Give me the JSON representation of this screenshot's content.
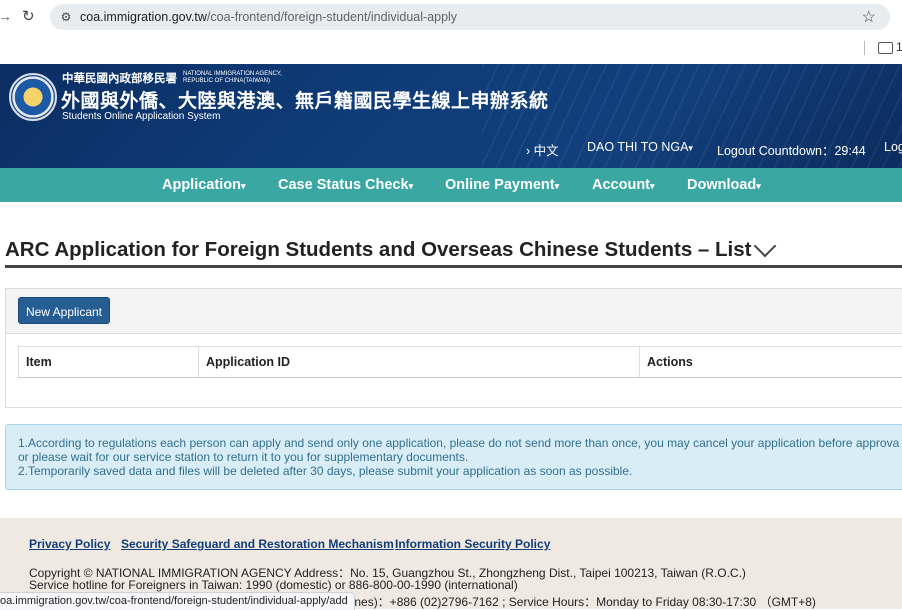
{
  "browser": {
    "url_host": "coa.immigration.gov.tw",
    "url_path": "/coa-frontend/foreign-student/individual-apply",
    "bookmark_label": "1",
    "status_url": "oa.immigration.gov.tw/coa-frontend/foreign-student/individual-apply/add"
  },
  "header": {
    "agency_cn": "中華民國內政部移民署",
    "agency_en": "NATIONAL IMMIGRATION AGENCY, REPUBLIC OF CHINA(TAIWAN)",
    "system_cn": "外國與外僑、大陸與港澳、無戶籍國民學生線上申辦系統",
    "system_en": "Students Online Application System",
    "lang_link": "› 中文",
    "user_name": "DAO THI TO NGA",
    "countdown_label": "Logout Countdown：",
    "countdown_value": "29:44",
    "logout_label": "Log"
  },
  "menu": {
    "items": [
      {
        "label": "Application"
      },
      {
        "label": "Case Status Check"
      },
      {
        "label": "Online Payment"
      },
      {
        "label": "Account"
      },
      {
        "label": "Download"
      }
    ]
  },
  "main": {
    "title": "ARC Application for Foreign Students and Overseas Chinese Students – List",
    "new_button": "New Applicant",
    "columns": [
      "Item",
      "Application ID",
      "Actions"
    ],
    "rows": []
  },
  "notice": {
    "line1": "1.According to regulations each person can apply and send only one application, please do not send more than once, you may cancel your application before approva",
    "line2": "or please wait for our service station to return it to you for supplementary documents.",
    "line3": "2.Temporarily saved data and files will be deleted after 30 days, please submit your application as soon as possible."
  },
  "footer": {
    "links": [
      "Privacy Policy",
      "Security Safeguard and Restoration Mechanism",
      "Information Security Policy"
    ],
    "copyright": "Copyright © NATIONAL IMMIGRATION AGENCY Address：No. 15, Guangzhou St., Zhongzheng Dist., Taipei 100213, Taiwan (R.O.C.)",
    "hotline": "Service hotline for Foreigners in Taiwan: 1990 (domestic) or 886-800-00-1990 (international)",
    "service_line": "ix Lines)：+886 (02)2796-7162 ; Service Hours：Monday to Friday 08:30-17:30 （GMT+8)"
  },
  "colors": {
    "header_bg": "#0f3d7a",
    "menu_bg": "#3aa7a3",
    "button_bg": "#265e94",
    "notice_bg": "#d9edf7",
    "footer_bg": "#efe9e2"
  }
}
